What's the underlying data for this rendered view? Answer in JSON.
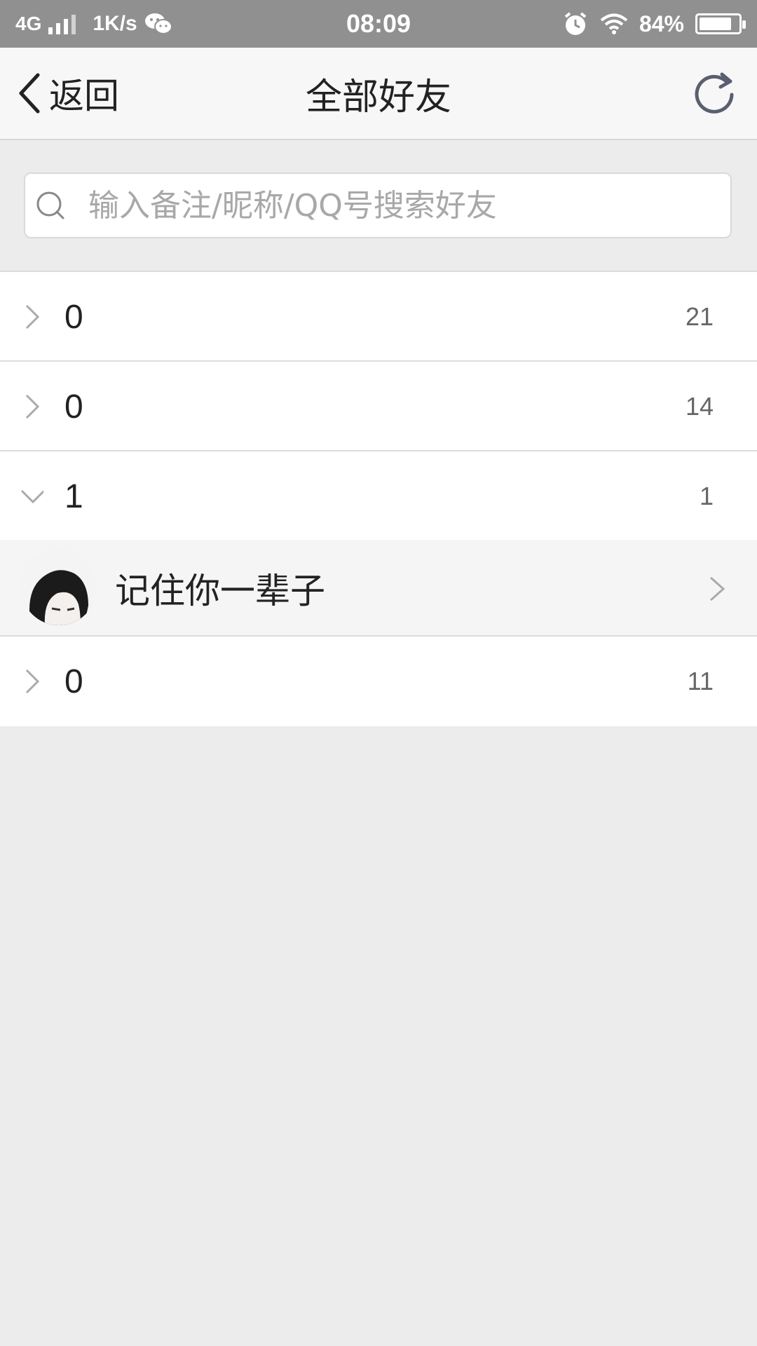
{
  "status_bar": {
    "network": "4G",
    "speed": "1K/s",
    "time": "08:09",
    "battery_percent": "84%",
    "battery_level": 0.84,
    "icons": [
      "signal-icon",
      "wechat-icon",
      "alarm-icon",
      "wifi-icon",
      "battery-icon"
    ]
  },
  "nav": {
    "back_label": "返回",
    "title": "全部好友",
    "refresh_icon": "refresh-icon"
  },
  "search": {
    "placeholder": "输入备注/昵称/QQ号搜索好友",
    "value": ""
  },
  "groups": [
    {
      "name": "0",
      "count": "21",
      "expanded": false
    },
    {
      "name": "0",
      "count": "14",
      "expanded": false
    },
    {
      "name": "1",
      "count": "1",
      "expanded": true,
      "friends": [
        {
          "name": "记住你一辈子"
        }
      ]
    },
    {
      "name": "0",
      "count": "11",
      "expanded": false
    }
  ],
  "colors": {
    "status_bar": "#909090",
    "nav_bg": "#f7f7f7",
    "page_bg": "#ececec",
    "row_bg": "#ffffff",
    "friend_row_bg": "#f5f5f5",
    "refresh_icon": "#5a5f70"
  }
}
